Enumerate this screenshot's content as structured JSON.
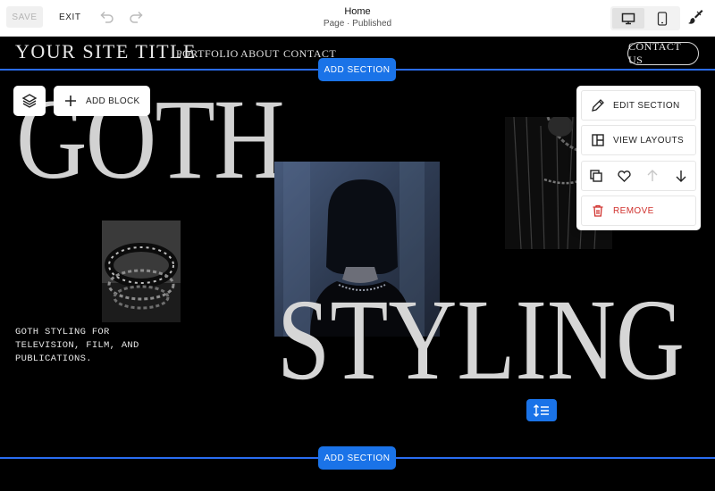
{
  "editor": {
    "save_label": "SAVE",
    "exit_label": "EXIT",
    "page_title": "Home",
    "page_status": "Page · Published"
  },
  "site": {
    "title": "YOUR SITE TITLE",
    "nav": [
      "PORTFOLIO",
      "ABOUT",
      "CONTACT"
    ],
    "contact_button": "CONTACT US"
  },
  "section": {
    "add_section_label": "ADD SECTION",
    "add_block_label": "ADD BLOCK",
    "headline_top": "GOTH",
    "headline_bottom": "STYLING",
    "caption": "GOTH STYLING FOR TELEVISION, FILM, AND PUBLICATIONS."
  },
  "context_menu": {
    "edit_section": "EDIT SECTION",
    "view_layouts": "VIEW LAYOUTS",
    "remove": "REMOVE"
  },
  "icons": {
    "undo": "undo-icon",
    "redo": "redo-icon",
    "desktop": "desktop-icon",
    "mobile": "mobile-icon",
    "brush": "paintbrush-icon",
    "layers": "layers-icon",
    "plus": "plus-icon",
    "pencil": "pencil-icon",
    "layout": "layout-icon",
    "duplicate": "duplicate-icon",
    "heart": "heart-icon",
    "arrow_up": "arrow-up-icon",
    "arrow_down": "arrow-down-icon",
    "trash": "trash-icon",
    "resize": "resize-icon"
  },
  "colors": {
    "accent": "#1a73e8",
    "remove": "#d0312d",
    "background": "#000000"
  }
}
